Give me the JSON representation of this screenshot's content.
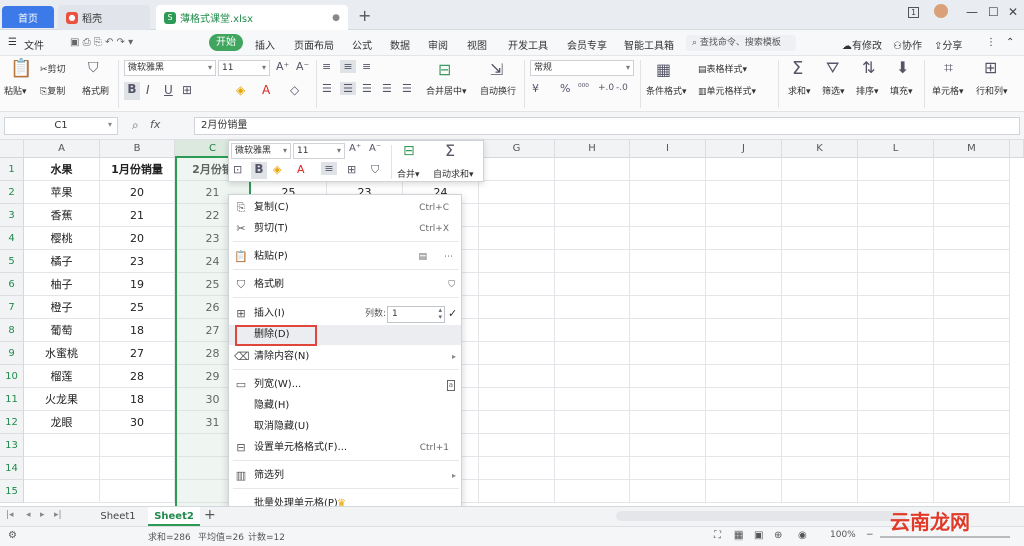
{
  "titlebar": {
    "tabs": [
      {
        "label": "首页"
      },
      {
        "label": "稻壳"
      },
      {
        "label": "薄格式课堂.xlsx"
      }
    ],
    "page_badge": "1"
  },
  "menubar": {
    "file_label": "文件",
    "start_label": "开始",
    "items": [
      "插入",
      "页面布局",
      "公式",
      "数据",
      "审阅",
      "视图",
      "开发工具",
      "会员专享",
      "智能工具箱"
    ],
    "search_placeholder": "查找命令、搜索模板",
    "right": [
      "有修改",
      "协作",
      "分享"
    ]
  },
  "ribbon": {
    "paste": "粘贴",
    "cut": "剪切",
    "copy": "复制",
    "format_painter": "格式刷",
    "font_name": "微软雅黑",
    "font_size": "11",
    "merge_center": "合并居中",
    "wrap": "自动换行",
    "number_format": "常规",
    "cond_format": "条件格式",
    "table_style": "表格样式",
    "cell_style": "单元格样式",
    "sum": "求和",
    "filter": "筛选",
    "sort": "排序",
    "fill": "填充",
    "cell": "单元格",
    "rowcol": "行和列"
  },
  "formula_bar": {
    "name_box": "C1",
    "fx": "fx",
    "value": "2月份销量"
  },
  "grid": {
    "columns": [
      "A",
      "B",
      "C",
      "D",
      "E",
      "F",
      "G",
      "H",
      "I",
      "J",
      "K",
      "L",
      "M"
    ],
    "rows": [
      "1",
      "2",
      "3",
      "4",
      "5",
      "6",
      "7",
      "8",
      "9",
      "10",
      "11",
      "12",
      "13",
      "14",
      "15"
    ],
    "header": [
      "水果",
      "1月份销量",
      "2月份销"
    ],
    "data": [
      [
        "苹果",
        "20",
        "21"
      ],
      [
        "香蕉",
        "21",
        "22"
      ],
      [
        "樱桃",
        "20",
        "23"
      ],
      [
        "橘子",
        "23",
        "24"
      ],
      [
        "柚子",
        "19",
        "25"
      ],
      [
        "橙子",
        "25",
        "26"
      ],
      [
        "葡萄",
        "18",
        "27"
      ],
      [
        "水蜜桃",
        "27",
        "28"
      ],
      [
        "榴莲",
        "28",
        "29"
      ],
      [
        "火龙果",
        "18",
        "30"
      ],
      [
        "龙眼",
        "30",
        "31"
      ]
    ],
    "row2_extra": [
      "25",
      "23",
      "24"
    ]
  },
  "minibar": {
    "font_name": "微软雅黑",
    "font_size": "11",
    "merge": "合并",
    "autosum": "自动求和"
  },
  "context_menu": {
    "items": [
      {
        "label": "复制(C)",
        "shortcut": "Ctrl+C"
      },
      {
        "label": "剪切(T)",
        "shortcut": "Ctrl+X"
      },
      {
        "label": "粘贴(P)"
      },
      {
        "label": "格式刷"
      },
      {
        "label": "插入(I)",
        "spin_label": "列数:",
        "spin_value": "1"
      },
      {
        "label": "删除(D)"
      },
      {
        "label": "清除内容(N)"
      },
      {
        "label": "列宽(W)..."
      },
      {
        "label": "隐藏(H)"
      },
      {
        "label": "取消隐藏(U)"
      },
      {
        "label": "设置单元格格式(F)...",
        "shortcut": "Ctrl+1"
      },
      {
        "label": "筛选列"
      },
      {
        "label": "批量处理单元格(P)"
      }
    ]
  },
  "sheets": {
    "tabs": [
      "Sheet1",
      "Sheet2"
    ],
    "active": "Sheet2"
  },
  "status": {
    "sum": "求和=286",
    "avg": "平均值=26",
    "count": "计数=12",
    "zoom": "100%"
  },
  "watermark": "云南龙网"
}
